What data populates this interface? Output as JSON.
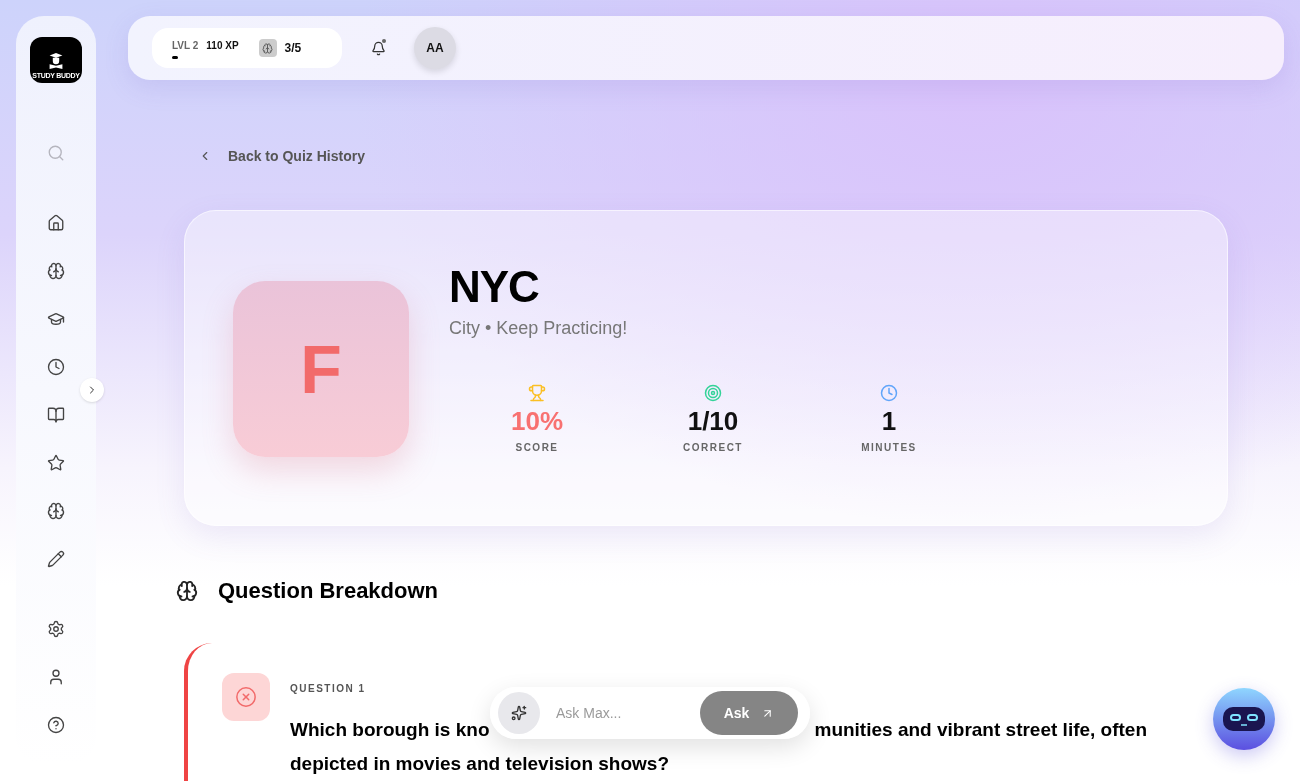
{
  "sidebar": {
    "logo_text": "STUDY BUDDY",
    "items": [
      {
        "kind": "search"
      },
      {
        "kind": "home"
      },
      {
        "kind": "brain"
      },
      {
        "kind": "graduation"
      },
      {
        "kind": "clock"
      },
      {
        "kind": "book"
      },
      {
        "kind": "star"
      },
      {
        "kind": "brain"
      },
      {
        "kind": "pencil"
      }
    ],
    "bottom_items": [
      {
        "kind": "settings"
      },
      {
        "kind": "user"
      },
      {
        "kind": "help"
      }
    ]
  },
  "header": {
    "level": "LVL 2",
    "xp": "110 XP",
    "xp_progress": {
      "level": 0.1
    },
    "quota": "3/5",
    "notification_dot": true,
    "avatar": "AA"
  },
  "back_link": "Back to Quiz History",
  "result": {
    "grade": "F",
    "title": "NYC",
    "subtitle": "City • Keep Practicing!",
    "stats": [
      {
        "kind": "trophy",
        "value": "10%",
        "label": "SCORE",
        "color": "#f87171"
      },
      {
        "kind": "target",
        "value": "1/10",
        "label": "CORRECT",
        "color": "#111111"
      },
      {
        "kind": "clock",
        "value": "1",
        "label": "MINUTES",
        "color": "#111111"
      }
    ]
  },
  "breakdown": {
    "title": "Question Breakdown",
    "questions": [
      {
        "label": "QUESTION 1",
        "correct": false,
        "text_start": "Which borough is kno",
        "text_line1_end": "munities and vibrant street life, often",
        "text_line2": "depicted in movies and television shows?"
      }
    ]
  },
  "assistant": {
    "placeholder": "Ask Max...",
    "button": "Ask"
  }
}
